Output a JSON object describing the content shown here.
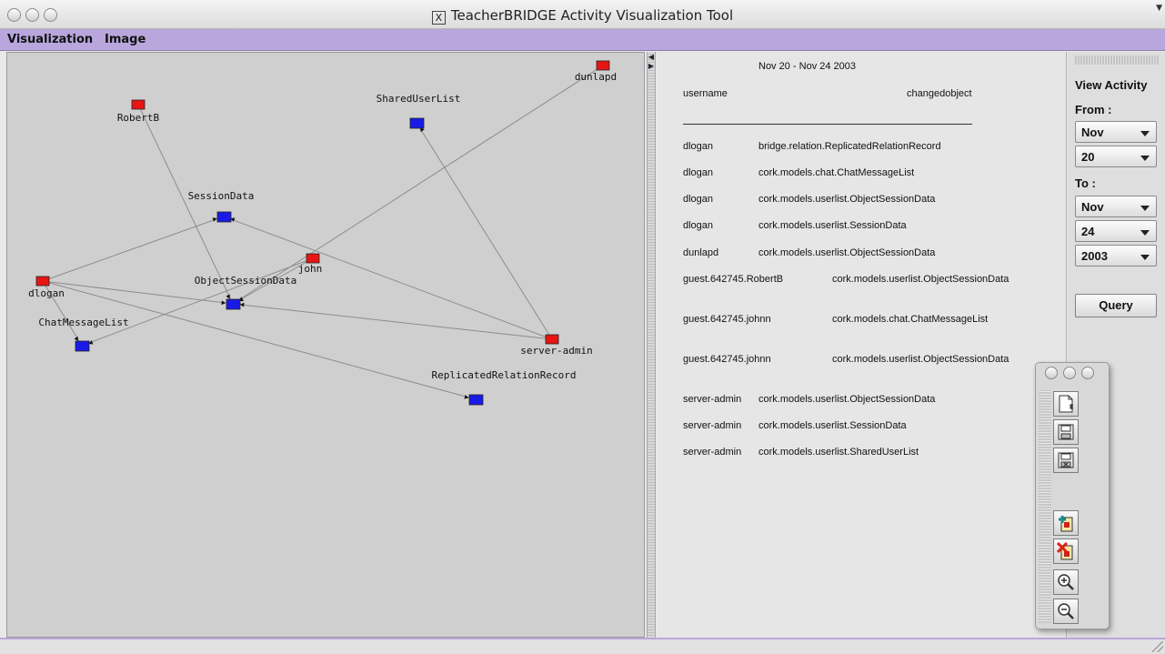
{
  "window": {
    "title": "TeacherBRIDGE Activity Visualization Tool",
    "x_glyph": "X"
  },
  "menubar": {
    "items": [
      {
        "label": "Visualization"
      },
      {
        "label": "Image"
      }
    ]
  },
  "graph": {
    "user_nodes": [
      "dunlapd",
      "RobertB",
      "john",
      "dlogan",
      "server-admin"
    ],
    "object_nodes": [
      "SharedUserList",
      "SessionData",
      "ObjectSessionData",
      "ChatMessageList",
      "ReplicatedRelationRecord"
    ],
    "colors": {
      "user_node": "#e81414",
      "object_node": "#1a1ae6",
      "edge": "#8c8c8c",
      "background": "#cfcfcf"
    }
  },
  "activity": {
    "date_range": "Nov 20  -  Nov 24 2003",
    "headers": {
      "username": "username",
      "changedobject": "changedobject"
    },
    "rows": [
      {
        "user": "dlogan",
        "object": "bridge.relation.ReplicatedRelationRecord"
      },
      {
        "user": "dlogan",
        "object": "cork.models.chat.ChatMessageList"
      },
      {
        "user": "dlogan",
        "object": "cork.models.userlist.ObjectSessionData"
      },
      {
        "user": "dlogan",
        "object": "cork.models.userlist.SessionData"
      },
      {
        "user": "dunlapd",
        "object": "cork.models.userlist.ObjectSessionData"
      },
      {
        "user": "guest.642745.RobertB",
        "object": "cork.models.userlist.ObjectSessionData"
      },
      {
        "user": "guest.642745.johnn",
        "object": "cork.models.chat.ChatMessageList"
      },
      {
        "user": "guest.642745.johnn",
        "object": "cork.models.userlist.ObjectSessionData"
      },
      {
        "user": "server-admin",
        "object": "cork.models.userlist.ObjectSessionData"
      },
      {
        "user": "server-admin",
        "object": "cork.models.userlist.SessionData"
      },
      {
        "user": "server-admin",
        "object": "cork.models.userlist.SharedUserList"
      }
    ]
  },
  "filter": {
    "heading": "View Activity",
    "from_label": "From :",
    "from_month": "Nov",
    "from_day": "20",
    "to_label": "To :",
    "to_month": "Nov",
    "to_day": "24",
    "to_year": "2003",
    "query_label": "Query"
  },
  "toolbox": {
    "tools": [
      "new-document-icon",
      "save-icon",
      "save-as-icon",
      "add-item-icon",
      "delete-item-icon",
      "zoom-in-icon",
      "zoom-out-icon"
    ]
  }
}
